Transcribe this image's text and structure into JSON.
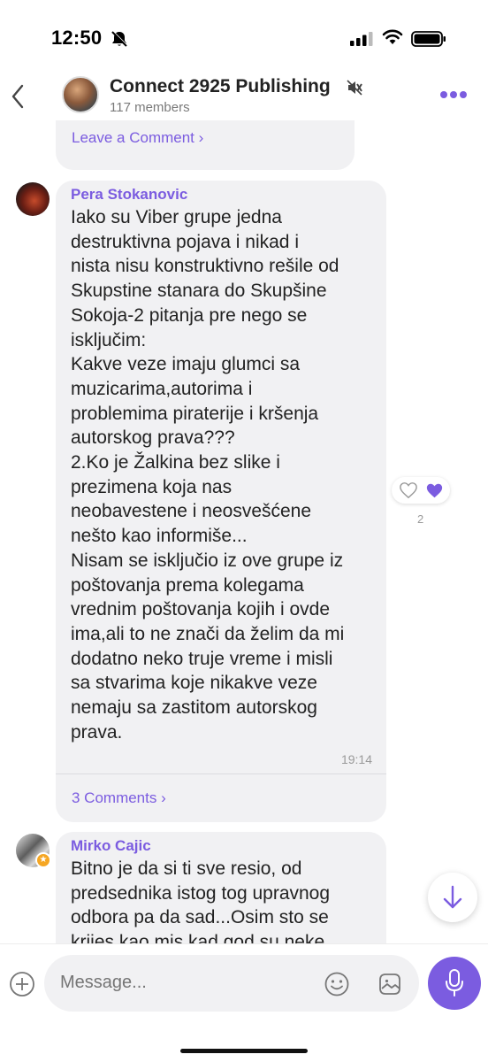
{
  "status": {
    "time": "12:50"
  },
  "header": {
    "title": "Connect 2925 Publishing",
    "members": "117 members"
  },
  "previous_message": {
    "link_label": "Leave a Comment ›"
  },
  "messages": [
    {
      "sender": "Pera Stokanovic",
      "text": "Iako su Viber grupe jedna\ndestruktivna pojava i nikad i\nnista nisu konstruktivno rešile od\nSkupstine stanara do Skupšine\nSokoja-2 pitanja pre nego se\nisključim:\nKakve veze imaju glumci sa\nmuzicarima,autorima i\nproblemima piraterije i kršenja\nautorskog prava???\n2.Ko je Žalkina bez slike i\nprezimena koja nas\nneobavestene i neosvešćene\nnešto kao informiše...\nNisam se isključio iz ove grupe iz\npoštovanja prema kolegama\nvrednim poštovanja kojih i ovde\nima,ali to ne znači da želim da mi\ndodatno neko truje vreme i misli\nsa stvarima koje nikakve veze\nnemaju sa zastitom autorskog\nprava.",
      "time": "19:14",
      "comments_label": "3 Comments ›",
      "reaction_count": "2"
    },
    {
      "sender": "Mirko Cajic",
      "text": "Bitno je da si ti sve resio, od\npredsednika istog tog upravnog\nodbora pa da sad...Osim sto se\nkrijes kao mis kad god su neke"
    }
  ],
  "composer": {
    "placeholder": "Message..."
  },
  "colors": {
    "accent": "#7b5ce0",
    "bubble": "#f1f1f3",
    "text": "#222222"
  },
  "icons": [
    "bell-slash-icon",
    "signal-icon",
    "wifi-icon",
    "battery-icon",
    "back-chevron-icon",
    "mute-icon",
    "more-icon",
    "heart-outline-icon",
    "heart-filled-icon",
    "arrow-down-icon",
    "plus-circle-icon",
    "smiley-icon",
    "sticker-icon",
    "microphone-icon"
  ]
}
